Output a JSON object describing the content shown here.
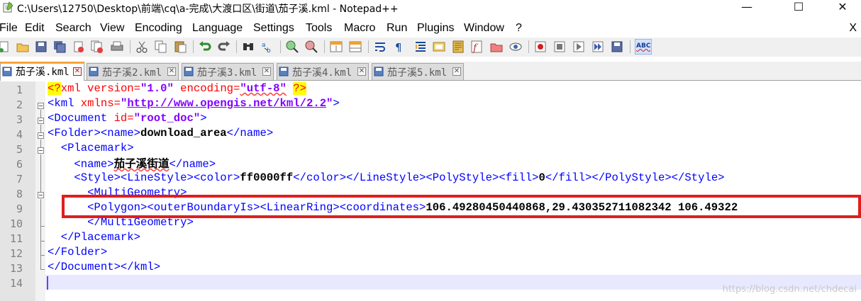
{
  "window": {
    "title": "C:\\Users\\12750\\Desktop\\前端\\cq\\a-完成\\大渡口区\\街道\\茄子溪.kml - Notepad++",
    "minimize": "—",
    "maximize": "☐",
    "close": "✕"
  },
  "menu": {
    "items": [
      "File",
      "Edit",
      "Search",
      "View",
      "Encoding",
      "Language",
      "Settings",
      "Tools",
      "Macro",
      "Run",
      "Plugins",
      "Window",
      "?"
    ],
    "close": "X"
  },
  "toolbar": {
    "icons": [
      "new-file-icon",
      "open-file-icon",
      "save-icon",
      "save-all-icon",
      "close-icon",
      "close-all-icon",
      "print-icon",
      "cut-icon",
      "copy-icon",
      "paste-icon",
      "undo-icon",
      "redo-icon",
      "find-icon",
      "replace-icon",
      "zoom-in-icon",
      "zoom-out-icon",
      "sync-vertical-icon",
      "sync-horizontal-icon",
      "word-wrap-icon",
      "show-all-chars-icon",
      "indent-guide-icon",
      "user-language-icon",
      "doc-map-icon",
      "function-list-icon",
      "folder-workspace-icon",
      "monitor-icon",
      "record-macro-icon",
      "stop-record-icon",
      "play-macro-icon",
      "run-macro-multiple-icon",
      "save-macro-icon",
      "spell-check-icon"
    ]
  },
  "tabs": [
    {
      "label": "茄子溪.kml",
      "active": true
    },
    {
      "label": "茄子溪2.kml",
      "active": false
    },
    {
      "label": "茄子溪3.kml",
      "active": false
    },
    {
      "label": "茄子溪4.kml",
      "active": false
    },
    {
      "label": "茄子溪5.kml",
      "active": false
    }
  ],
  "editor": {
    "line_numbers": [
      "1",
      "2",
      "3",
      "4",
      "5",
      "6",
      "7",
      "8",
      "9",
      "10",
      "11",
      "12",
      "13",
      "14"
    ],
    "lines": {
      "l1": {
        "p1": "<?",
        "p2": "xml version=",
        "p3": "\"1.0\"",
        "p4": " encoding=",
        "p5": "\"utf-8\"",
        "p6": " ",
        "p7": "?>"
      },
      "l2": {
        "p1": "<kml ",
        "p2": "xmlns=",
        "p3": "\"",
        "p4": "http://www.opengis.net/kml/2.2",
        "p5": "\"",
        "p6": ">"
      },
      "l3": {
        "p1": "<Document ",
        "p2": "id=",
        "p3": "\"root_doc\"",
        "p4": ">"
      },
      "l4": {
        "p1": "<Folder><name>",
        "p2": "download_area",
        "p3": "</name>"
      },
      "l5": {
        "p1": "  <Placemark>"
      },
      "l6": {
        "p1": "    <name>",
        "p2": "茄子溪街道",
        "p3": "</name>"
      },
      "l7": {
        "p1": "    <Style><LineStyle><color>",
        "p2": "ff0000ff",
        "p3": "</color></LineStyle><PolyStyle><fill>",
        "p4": "0",
        "p5": "</fill></PolyStyle></Style>"
      },
      "l8": {
        "p1": "      <MultiGeometry>"
      },
      "l9": {
        "p1": "      <Polygon><outerBoundaryIs><LinearRing><coordinates>",
        "p2": "106.49280450440868,29.430352711082342 106.49322"
      },
      "l10": {
        "p1": "      </MultiGeometry>"
      },
      "l11": {
        "p1": "  </Placemark>"
      },
      "l12": {
        "p1": "</Folder>"
      },
      "l13": {
        "p1": "</Document></kml>"
      },
      "l14": {
        "p1": ""
      }
    }
  },
  "watermark": "https://blog.csdn.net/chdecai",
  "colors": {
    "tag": "#0000ff",
    "attribute": "#ff0000",
    "string": "#8000ff",
    "highlight_box": "#e01e1e",
    "active_tab_accent": "#f8a53a"
  }
}
